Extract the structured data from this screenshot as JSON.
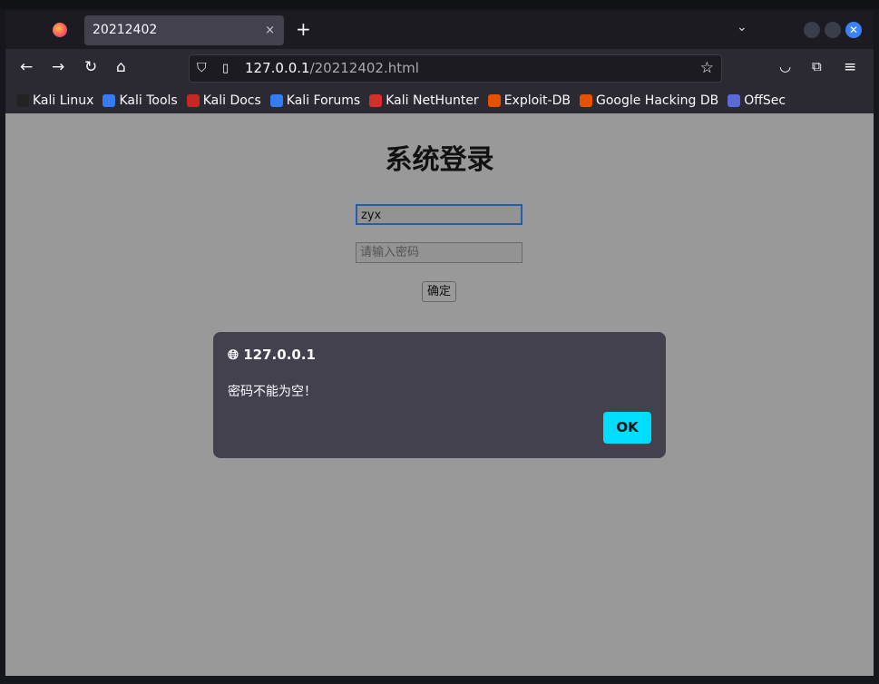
{
  "tab": {
    "title": "20212402",
    "close": "×",
    "new_tab": "+"
  },
  "nav": {
    "back": "←",
    "forward": "→",
    "reload": "↻",
    "home": "⌂",
    "url_host": "127.0.0.1",
    "url_path": "/20212402.html",
    "star": "☆",
    "menu": "≡"
  },
  "bookmarks": [
    {
      "label": "Kali Linux",
      "color": "#222"
    },
    {
      "label": "Kali Tools",
      "color": "#367bf0"
    },
    {
      "label": "Kali Docs",
      "color": "#c62828"
    },
    {
      "label": "Kali Forums",
      "color": "#367bf0"
    },
    {
      "label": "Kali NetHunter",
      "color": "#d32f2f"
    },
    {
      "label": "Exploit-DB",
      "color": "#e65100"
    },
    {
      "label": "Google Hacking DB",
      "color": "#e65100"
    },
    {
      "label": "OffSec",
      "color": "#5b6bd6"
    }
  ],
  "page": {
    "title": "系统登录",
    "username_value": "zyx",
    "password_placeholder": "请输入密码",
    "submit": "确定"
  },
  "dialog": {
    "origin": "127.0.0.1",
    "message": "密码不能为空！",
    "ok": "OK"
  }
}
